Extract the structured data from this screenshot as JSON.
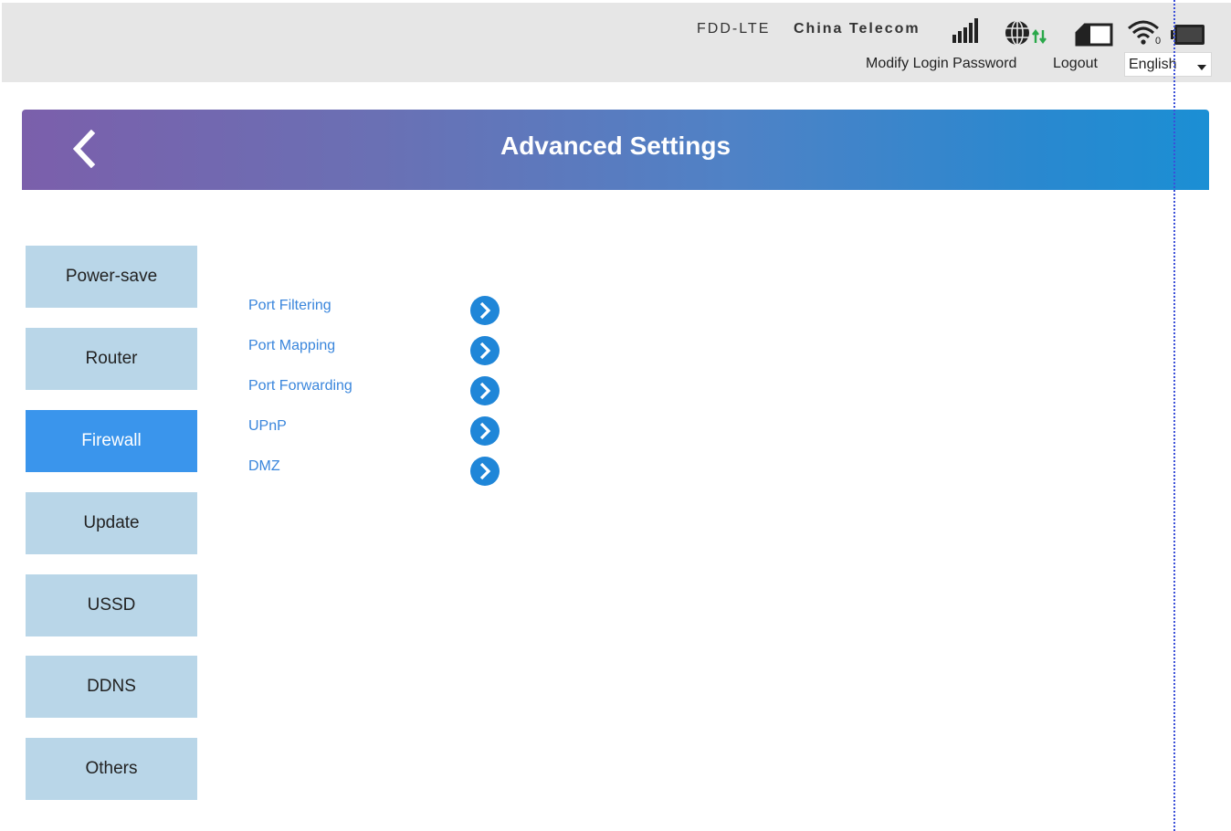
{
  "status_bar": {
    "network_type": "FDD-LTE",
    "carrier": "China Telecom",
    "icons": [
      "signal-icon",
      "globe-icon",
      "sim-icon",
      "wifi-icon",
      "battery-icon"
    ],
    "wifi_clients": "0",
    "modify_password": "Modify Login Password",
    "logout": "Logout",
    "language": "English"
  },
  "header": {
    "title": "Advanced Settings",
    "back_icon": "chevron-left-icon",
    "gradient_colors": [
      "#7b5fab",
      "#1b8fd4"
    ]
  },
  "sidebar": {
    "items": [
      {
        "label": "Power-save",
        "active": false
      },
      {
        "label": "Router",
        "active": false
      },
      {
        "label": "Firewall",
        "active": true
      },
      {
        "label": "Update",
        "active": false
      },
      {
        "label": "USSD",
        "active": false
      },
      {
        "label": "DDNS",
        "active": false
      },
      {
        "label": "Others",
        "active": false
      }
    ],
    "active_color": "#3a95ec",
    "inactive_color": "#b9d6e8"
  },
  "firewall_menu": {
    "items": [
      {
        "label": "Port Filtering"
      },
      {
        "label": "Port Mapping"
      },
      {
        "label": "Port Forwarding"
      },
      {
        "label": "UPnP"
      },
      {
        "label": "DMZ"
      }
    ],
    "arrow_icon": "chevron-right-circle-icon",
    "link_color": "#3a86dc"
  }
}
